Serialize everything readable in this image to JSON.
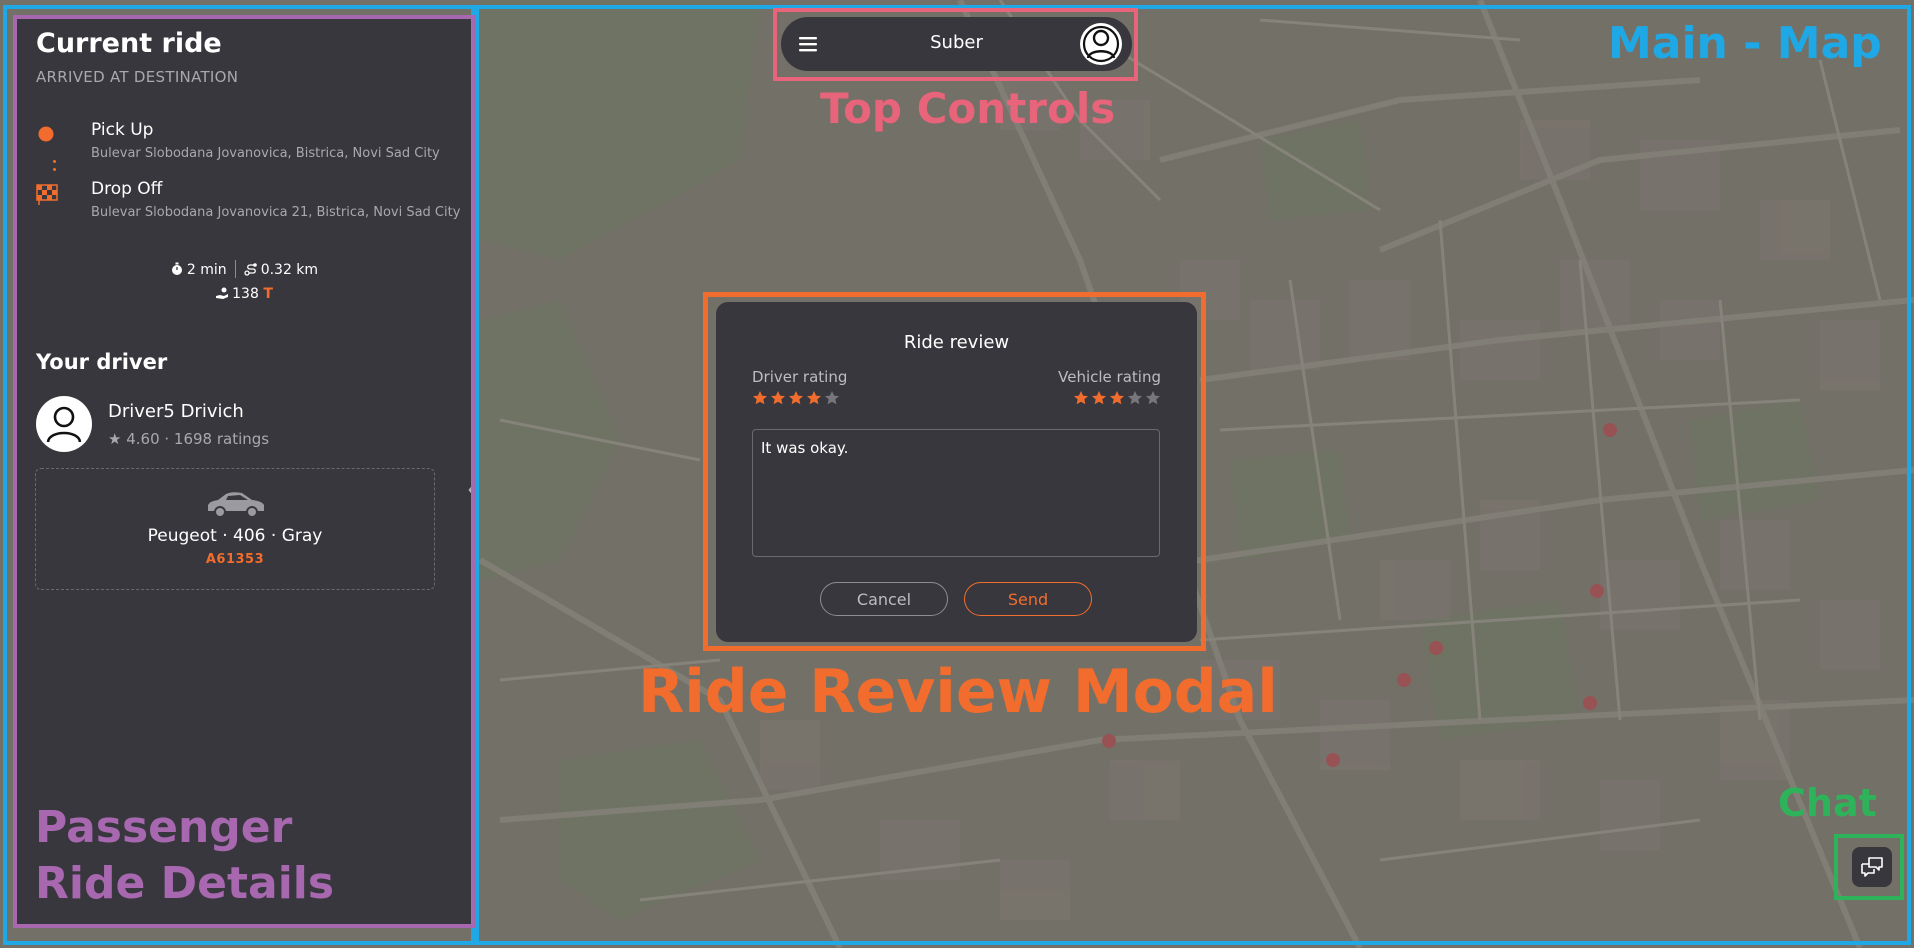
{
  "colors": {
    "accent": "#f26d2d",
    "panel": "#38373d",
    "muted_text": "#a9a8ae",
    "annotation_main_map": "#1ea8e6",
    "annotation_top_controls": "#e7647a",
    "annotation_modal": "#f26d2d",
    "annotation_sidebar": "#a768b0",
    "annotation_chat": "#2fb35a"
  },
  "sidebar": {
    "title": "Current ride",
    "status": "ARRIVED AT DESTINATION",
    "pickup": {
      "label": "Pick Up",
      "address": "Bulevar Slobodana Jovanovica, Bistrica, Novi Sad City",
      "icon": "pickup-dot-icon"
    },
    "dropoff": {
      "label": "Drop Off",
      "address": "Bulevar Slobodana Jovanovica 21, Bistrica, Novi Sad City",
      "icon": "checkered-flag-icon"
    },
    "stats": {
      "duration": "2 min",
      "distance": "0.32 km",
      "price": "138",
      "currency": "T"
    },
    "driver_heading": "Your driver",
    "driver": {
      "name": "Driver5 Drivich",
      "rating": "★ 4.60 · 1698 ratings"
    },
    "vehicle": {
      "description": "Peugeot · 406 · Gray",
      "plate": "A61353"
    }
  },
  "topbar": {
    "title": "Suber"
  },
  "modal": {
    "title": "Ride review",
    "driver_rating_label": "Driver rating",
    "vehicle_rating_label": "Vehicle rating",
    "driver_rating": 4,
    "vehicle_rating": 3,
    "max_rating": 5,
    "review_text": "It was okay.",
    "cancel_label": "Cancel",
    "send_label": "Send"
  },
  "annotations": {
    "main_map": "Main - Map",
    "top_controls": "Top Controls",
    "modal": "Ride Review Modal",
    "sidebar_line1": "Passenger",
    "sidebar_line2": "Ride Details",
    "chat": "Chat"
  }
}
